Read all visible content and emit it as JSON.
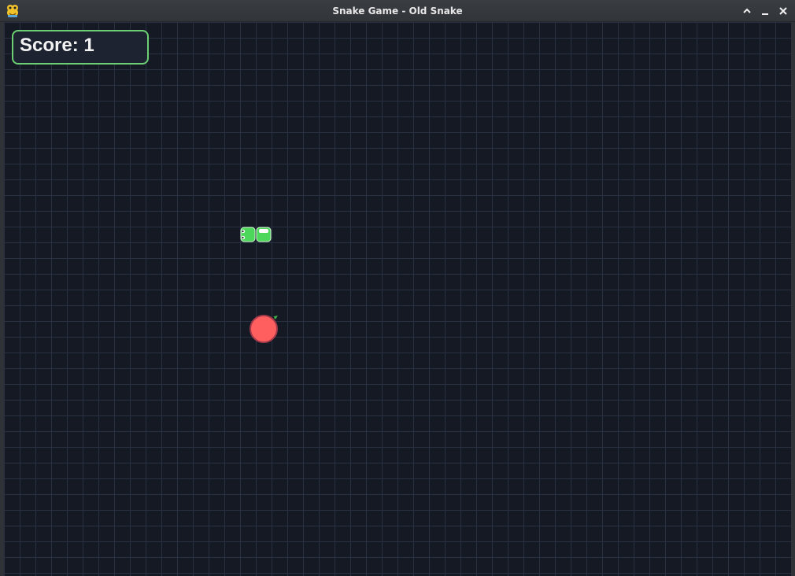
{
  "window": {
    "title": "Snake Game - Old Snake",
    "app_icon": "pygame-snake-icon",
    "controls": [
      "maximize-icon",
      "minimize-icon",
      "close-icon"
    ]
  },
  "game": {
    "score_text": "Score: 1",
    "snake_direction": "left",
    "snake_length": 2,
    "colors": {
      "background": "#141924",
      "grid": "#283041",
      "snake": "#4cd65a",
      "snake_outline": "#d8ffd8",
      "food": "#ff5f5f",
      "food_outline": "#a33a4a",
      "food_stem": "#3fae4a",
      "score_border": "#6ccf73"
    }
  }
}
